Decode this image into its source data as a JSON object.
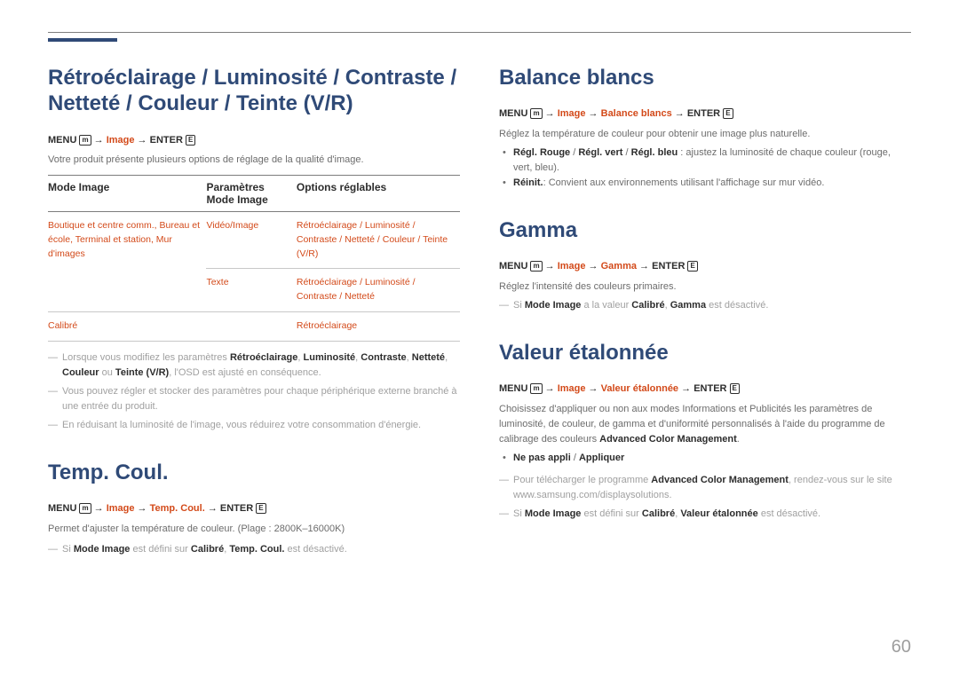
{
  "page_number": "60",
  "left": {
    "s1": {
      "heading_l1": "Rétroéclairage / Luminosité / Contraste /",
      "heading_l2": "Netteté / Couleur / Teinte (V/R)",
      "menu_pre": "MENU ",
      "menu_icon": "m",
      "menu_mid1": " → ",
      "menu_red1": "Image",
      "menu_mid2": " → ",
      "menu_post": "ENTER ",
      "enter_icon": "E",
      "desc1": "Votre produit présente plusieurs options de réglage de la qualité d'image.",
      "table": {
        "h1": "Mode Image",
        "h2": "Paramètres Mode Image",
        "h3": "Options réglables",
        "r1c1": "Boutique et centre comm., Bureau et école, Terminal et station, Mur d'images",
        "r1c2": "Vidéo/Image",
        "r1c3": "Rétroéclairage / Luminosité / Contraste / Netteté / Couleur / Teinte (V/R)",
        "r2c2": "Texte",
        "r2c3": "Rétroéclairage / Luminosité / Contraste / Netteté",
        "r3c1": "Calibré",
        "r3c3": "Rétroéclairage"
      },
      "note1_pre": "Lorsque vous modifiez les paramètres ",
      "note1_b1": "Rétroéclairage",
      "note1_s1": ", ",
      "note1_b2": "Luminosité",
      "note1_s2": ", ",
      "note1_b3": "Contraste",
      "note1_s3": ", ",
      "note1_b4": "Netteté",
      "note1_s4": ", ",
      "note1_b5": "Couleur",
      "note1_s5": " ou ",
      "note1_b6": "Teinte (V/R)",
      "note1_post": ", l'OSD est ajusté en conséquence.",
      "note2": "Vous pouvez régler et stocker des paramètres pour chaque périphérique externe branché à une entrée du produit.",
      "note3": "En réduisant la luminosité de l'image, vous réduirez votre consommation d'énergie."
    },
    "s2": {
      "heading": "Temp. Coul.",
      "menu_pre": "MENU ",
      "menu_icon": "m",
      "menu_mid1": " → ",
      "menu_red1": "Image",
      "menu_mid2": " → ",
      "menu_red2": "Temp. Coul.",
      "menu_mid3": " → ",
      "menu_post": "ENTER ",
      "enter_icon": "E",
      "desc": "Permet d'ajuster la température de couleur. (Plage : 2800K–16000K)",
      "note_pre": "Si ",
      "note_b1": "Mode Image",
      "note_mid1": " est défini sur ",
      "note_r1": "Calibré",
      "note_mid2": ", ",
      "note_b2": "Temp. Coul.",
      "note_post": " est désactivé."
    }
  },
  "right": {
    "s1": {
      "heading": "Balance blancs",
      "menu_pre": "MENU ",
      "menu_icon": "m",
      "menu_mid1": " → ",
      "menu_red1": "Image",
      "menu_mid2": " → ",
      "menu_red2": "Balance blancs",
      "menu_mid3": " → ",
      "menu_post": "ENTER ",
      "enter_icon": "E",
      "desc": "Réglez la température de couleur pour obtenir une image plus naturelle.",
      "b1_r1": "Régl. Rouge",
      "b1_s1": " / ",
      "b1_r2": "Régl. vert",
      "b1_s2": " / ",
      "b1_r3": "Régl. bleu",
      "b1_post": " : ajustez la luminosité de chaque couleur (rouge, vert, bleu).",
      "b2_r": "Réinit.",
      "b2_post": ": Convient aux environnements utilisant l'affichage sur mur vidéo."
    },
    "s2": {
      "heading": "Gamma",
      "menu_pre": "MENU ",
      "menu_icon": "m",
      "menu_mid1": " → ",
      "menu_red1": "Image",
      "menu_mid2": " → ",
      "menu_red2": "Gamma",
      "menu_mid3": " → ",
      "menu_post": "ENTER ",
      "enter_icon": "E",
      "desc": "Réglez l'intensité des couleurs primaires.",
      "note_pre": "Si ",
      "note_b1": "Mode Image",
      "note_mid1": " a la valeur ",
      "note_r1": "Calibré",
      "note_mid2": ", ",
      "note_b2": "Gamma",
      "note_post": " est désactivé."
    },
    "s3": {
      "heading": "Valeur étalonnée",
      "menu_pre": "MENU ",
      "menu_icon": "m",
      "menu_mid1": " → ",
      "menu_red1": "Image",
      "menu_mid2": " → ",
      "menu_red2": "Valeur étalonnée",
      "menu_mid3": " → ",
      "menu_post": "ENTER ",
      "enter_icon": "E",
      "desc": "Choisissez d'appliquer ou non aux modes Informations et Publicités les paramètres de luminosité, de couleur, de gamma et d'uniformité personnalisés à l'aide du programme de calibrage des couleurs ",
      "desc_b": "Advanced Color Management",
      "desc_end": ".",
      "opt_r1": "Ne pas appli",
      "opt_s": " / ",
      "opt_r2": "Appliquer",
      "note1_pre": "Pour télécharger le programme ",
      "note1_b": "Advanced Color Management",
      "note1_mid": ", rendez-vous sur le site ",
      "note1_url": "www.samsung.com/displaysolutions.",
      "note2_pre": "Si ",
      "note2_b1": "Mode Image",
      "note2_mid1": " est défini sur ",
      "note2_r1": "Calibré",
      "note2_mid2": ", ",
      "note2_b2": "Valeur étalonnée",
      "note2_post": " est désactivé."
    }
  }
}
